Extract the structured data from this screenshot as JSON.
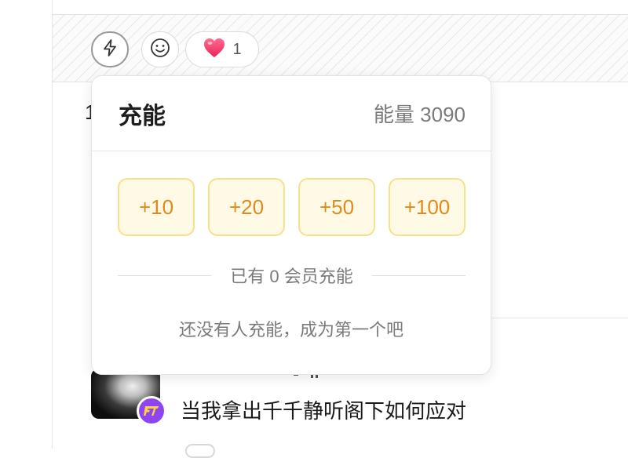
{
  "reactions": {
    "charge_icon": "lightning-icon",
    "emoji_icon": "smiley-icon",
    "like_icon": "heart-icon",
    "like_count": "1"
  },
  "background": {
    "partial_text": "1",
    "comment_text": "当我拿出千千静听阁下如何应对"
  },
  "popover": {
    "title": "充能",
    "energy": "能量 3090",
    "amounts": [
      "+10",
      "+20",
      "+50",
      "+100"
    ],
    "divider_label": "已有 0 会员充能",
    "empty_message": "还没有人充能，成为第一个吧"
  },
  "colors": {
    "heart": "#ff3d6e",
    "amount_text": "#e0891c",
    "amount_bg": "#fffae6",
    "amount_border": "#f6e08c",
    "badge": "#8e44f0"
  }
}
